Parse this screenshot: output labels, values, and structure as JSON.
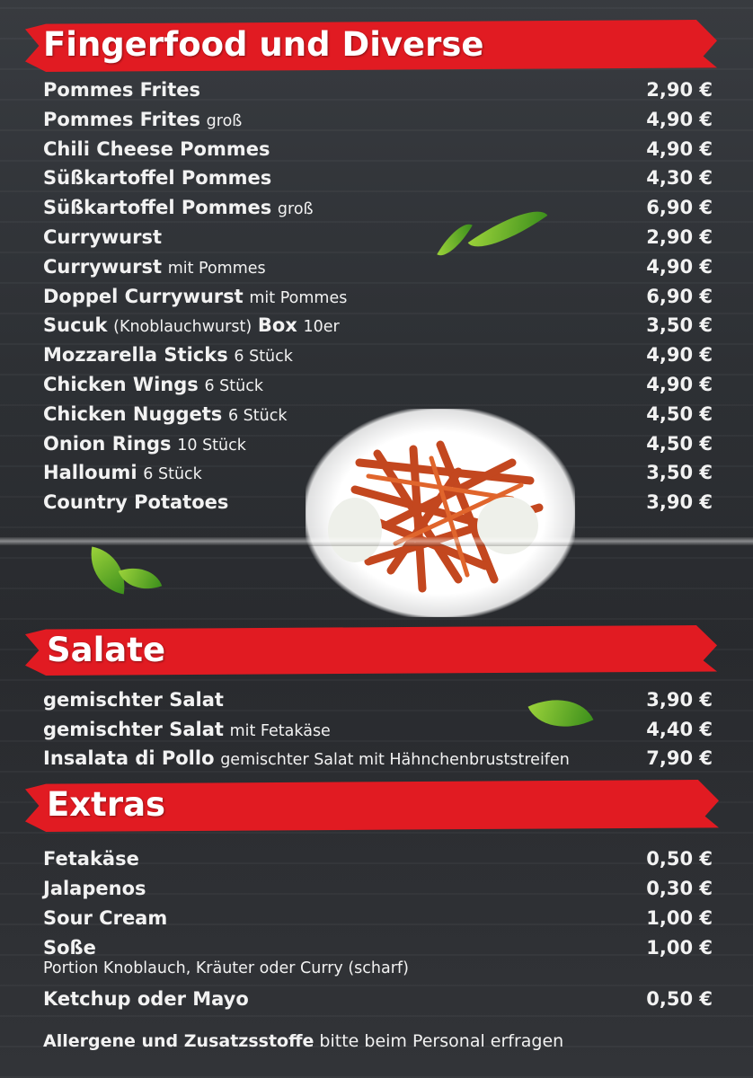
{
  "sections": {
    "fingerfood": {
      "title": "Fingerfood und Diverse",
      "items": [
        {
          "name": "Pommes Frites",
          "note": "",
          "price": "2,90 €"
        },
        {
          "name": "Pommes Frites",
          "note": "groß",
          "price": "4,90 €"
        },
        {
          "name": "Chili Cheese Pommes",
          "note": "",
          "price": "4,90 €"
        },
        {
          "name": "Süßkartoffel Pommes",
          "note": "",
          "price": "4,30 €"
        },
        {
          "name": "Süßkartoffel Pommes",
          "note": "groß",
          "price": "6,90 €"
        },
        {
          "name": "Currywurst",
          "note": "",
          "price": "2,90 €"
        },
        {
          "name": "Currywurst",
          "note": "mit Pommes",
          "price": "4,90 €"
        },
        {
          "name": "Doppel Currywurst",
          "note": "mit Pommes",
          "price": "6,90 €"
        },
        {
          "name": "Sucuk",
          "note": "(Knoblauchwurst)",
          "name2": "Box",
          "note2": "10er",
          "price": "3,50 €"
        },
        {
          "name": "Mozzarella Sticks",
          "note": "6 Stück",
          "price": "4,90 €"
        },
        {
          "name": "Chicken Wings",
          "note": "6 Stück",
          "price": "4,90 €"
        },
        {
          "name": "Chicken Nuggets",
          "note": "6 Stück",
          "price": "4,50 €"
        },
        {
          "name": "Onion Rings",
          "note": "10 Stück",
          "price": "4,50 €"
        },
        {
          "name": "Halloumi",
          "note": "6 Stück",
          "price": "3,50 €"
        },
        {
          "name": "Country Potatoes",
          "note": "",
          "price": "3,90 €"
        }
      ]
    },
    "salate": {
      "title": "Salate",
      "items": [
        {
          "name": "gemischter Salat",
          "note": "",
          "price": "3,90 €"
        },
        {
          "name": "gemischter Salat",
          "note": "mit Fetakäse",
          "price": "4,40 €"
        },
        {
          "name": "Insalata di Pollo",
          "note": "gemischter Salat mit Hähnchenbruststreifen",
          "price": "7,90 €"
        }
      ]
    },
    "extras": {
      "title": "Extras",
      "items": [
        {
          "name": "Fetakäse",
          "price": "0,50 €"
        },
        {
          "name": "Jalapenos",
          "price": "0,30 €"
        },
        {
          "name": "Sour Cream",
          "price": "1,00 €"
        },
        {
          "name": "Soße",
          "price": "1,00 €"
        }
      ],
      "sauce_options": "Portion Knoblauch, Kräuter oder Curry (scharf)",
      "last_item": {
        "name": "Ketchup oder Mayo",
        "price": "0,50 €"
      }
    }
  },
  "footer": {
    "bold": "Allergene und Zusatzsstoffe",
    "rest": "bitte beim Personal erfragen"
  },
  "colors": {
    "banner": "#e11b22",
    "background": "#2f3236",
    "text": "#f2f2f2"
  }
}
